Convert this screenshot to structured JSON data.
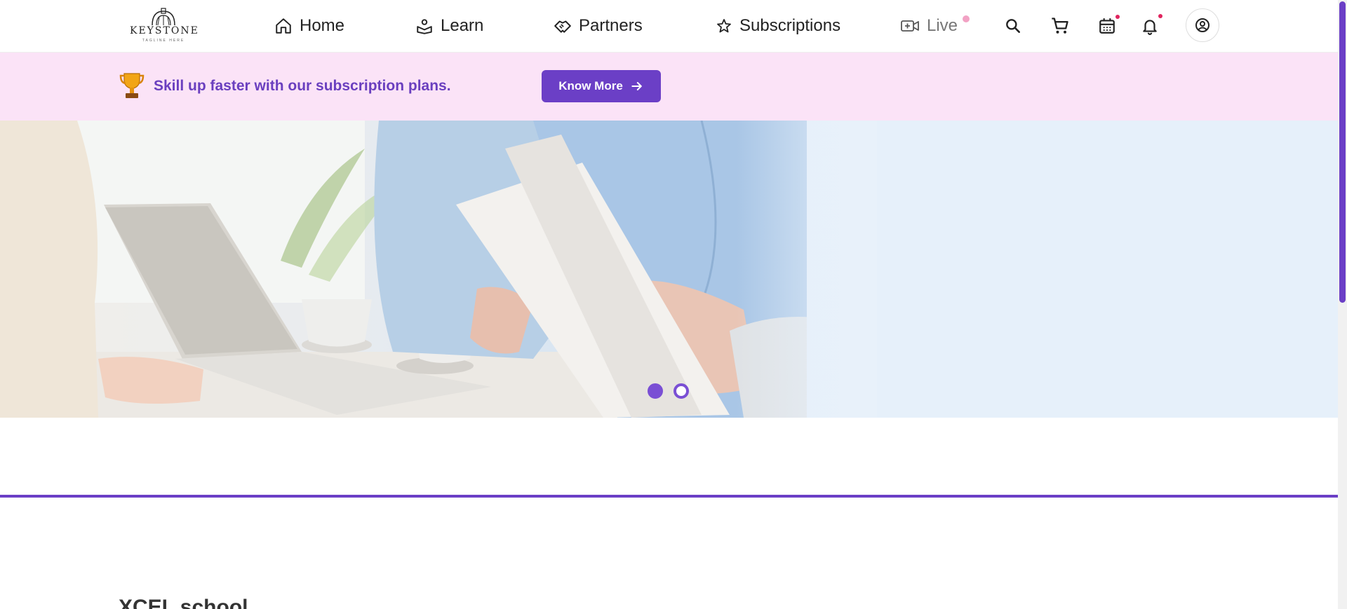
{
  "header": {
    "logo": {
      "name": "KEYSTONE",
      "tagline": "TAGLINE HERE"
    },
    "nav": [
      {
        "label": "Home",
        "icon": "home-icon"
      },
      {
        "label": "Learn",
        "icon": "learn-icon"
      },
      {
        "label": "Partners",
        "icon": "handshake-icon"
      },
      {
        "label": "Subscriptions",
        "icon": "star-icon"
      },
      {
        "label": "Live",
        "icon": "video-plus-icon"
      }
    ],
    "actions": [
      "search-icon",
      "cart-icon",
      "calendar-icon",
      "bell-icon",
      "user-circle-icon"
    ]
  },
  "promo": {
    "text": "Skill up faster with our subscription plans.",
    "button_label": "Know More",
    "icon": "trophy-icon"
  },
  "hero": {
    "slides_total": 2,
    "active_slide": 1
  },
  "section": {
    "heading": "XCEL school"
  },
  "colors": {
    "accent": "#6b3fc6",
    "promo_bg": "#fbe3f7",
    "promo_text": "#6a3fbf",
    "notification_dot": "#e0245e",
    "live_dot": "#f2a2c4"
  }
}
